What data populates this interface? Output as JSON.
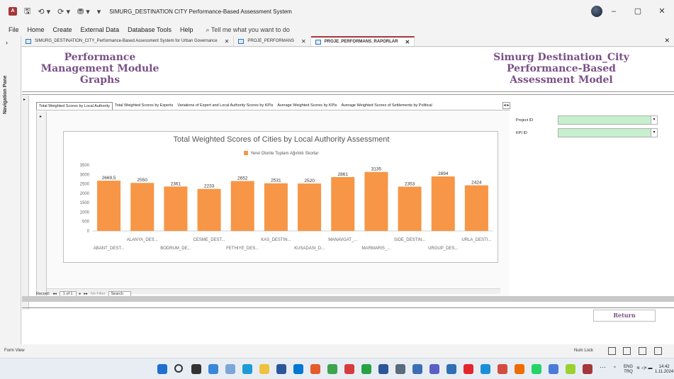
{
  "window": {
    "title": "SIMURG_DESTINATION CITY Performance-Based Assessment System",
    "app_badge": "A",
    "qat": {
      "save": "🖫",
      "undo": "⟲ ▾",
      "redo": "⟳ ▾",
      "extra": "⛃ ▾",
      "customize": "▾"
    },
    "controls": {
      "minimize": "–",
      "restore": "▢",
      "close": "✕"
    }
  },
  "menu": {
    "items": [
      "File",
      "Home",
      "Create",
      "External Data",
      "Database Tools",
      "Help"
    ],
    "tell_me": "Tell me what you want to do",
    "search_glyph": "⌕"
  },
  "nav_pane": {
    "label": "Navigation Pane",
    "toggle": "›"
  },
  "doc_tabs": [
    {
      "label": "SIMURG_DESTINATION_CITY_Performance-Based Assessment System for Urban Governance",
      "close": "✕"
    },
    {
      "label": "PROJE_PERFORMANS",
      "close": "✕"
    },
    {
      "label": "PROJE_PERFORMANS_RAPORLAR",
      "close": "✕"
    }
  ],
  "doc_close": "✕",
  "form": {
    "left_title": [
      "Performance",
      "Management Module",
      "Graphs"
    ],
    "right_title": [
      "Simurg Destination_City",
      "Performance-Based",
      "Assessment Model"
    ],
    "record_selector": "▸",
    "subtabs": [
      "Total Weighted Scores by Local Authority",
      "Total Weighted Scores by Experts",
      "Variations of Expert and Local Authority Scores by KPIs",
      "Average Weighted Scores by KPIs",
      "Average Weighted Scores of Settlements by Political"
    ],
    "subtab_scroll": "◂ ▸",
    "fields": [
      {
        "label": "Project ID",
        "value": ""
      },
      {
        "label": "KPI ID",
        "value": ""
      }
    ],
    "combo_arrow": "▾",
    "return_label": "Return",
    "record_nav": {
      "prefix": "Record:",
      "first": "◂◂",
      "prev": "◂",
      "position": "1 of 1",
      "next": "▸",
      "last": "▸▸",
      "no_filter": "No Filter",
      "search": "Search"
    }
  },
  "chart_data": {
    "type": "bar",
    "title": "Total Weighted Scores of Cities by Local Authority Assessment",
    "series": [
      {
        "name": "Yerel Otorite Toplam Ağırlıklı Skorlar",
        "color": "#f79646",
        "values": [
          2669.5,
          2550,
          2361,
          2233,
          2652,
          2531,
          2520,
          2861,
          3135,
          2353,
          2894,
          2424
        ]
      }
    ],
    "value_labels": [
      "2669,5",
      "2550",
      "2361",
      "2233",
      "2652",
      "2531",
      "2520",
      "2861",
      "3135",
      "2353",
      "2894",
      "2424"
    ],
    "categories": [
      "ABANT_DEST...",
      "ALANYA_DES...",
      "BODRUM_DE...",
      "CESME_DEST...",
      "FETHIYE_DES...",
      "KAS_DESTIN...",
      "KUSADASI_D...",
      "MANAVGAT_...",
      "MARMARIS_...",
      "SIDE_DESTIN...",
      "URGUP_DES...",
      "URLA_DESTI..."
    ],
    "y_ticks": [
      0,
      500,
      1000,
      1500,
      2000,
      2500,
      3000,
      3500
    ],
    "ylim": [
      0,
      3500
    ],
    "grid": false,
    "legend_position": "top"
  },
  "status": {
    "view": "Form View",
    "num_lock": "Num Lock"
  },
  "taskbar": {
    "overflow": "···",
    "tray_caret": "^",
    "language": [
      "ENG",
      "TRQ"
    ],
    "tray_icons": "≋ ◁× ▬",
    "time": "14:42",
    "date": "1.11.2024"
  }
}
